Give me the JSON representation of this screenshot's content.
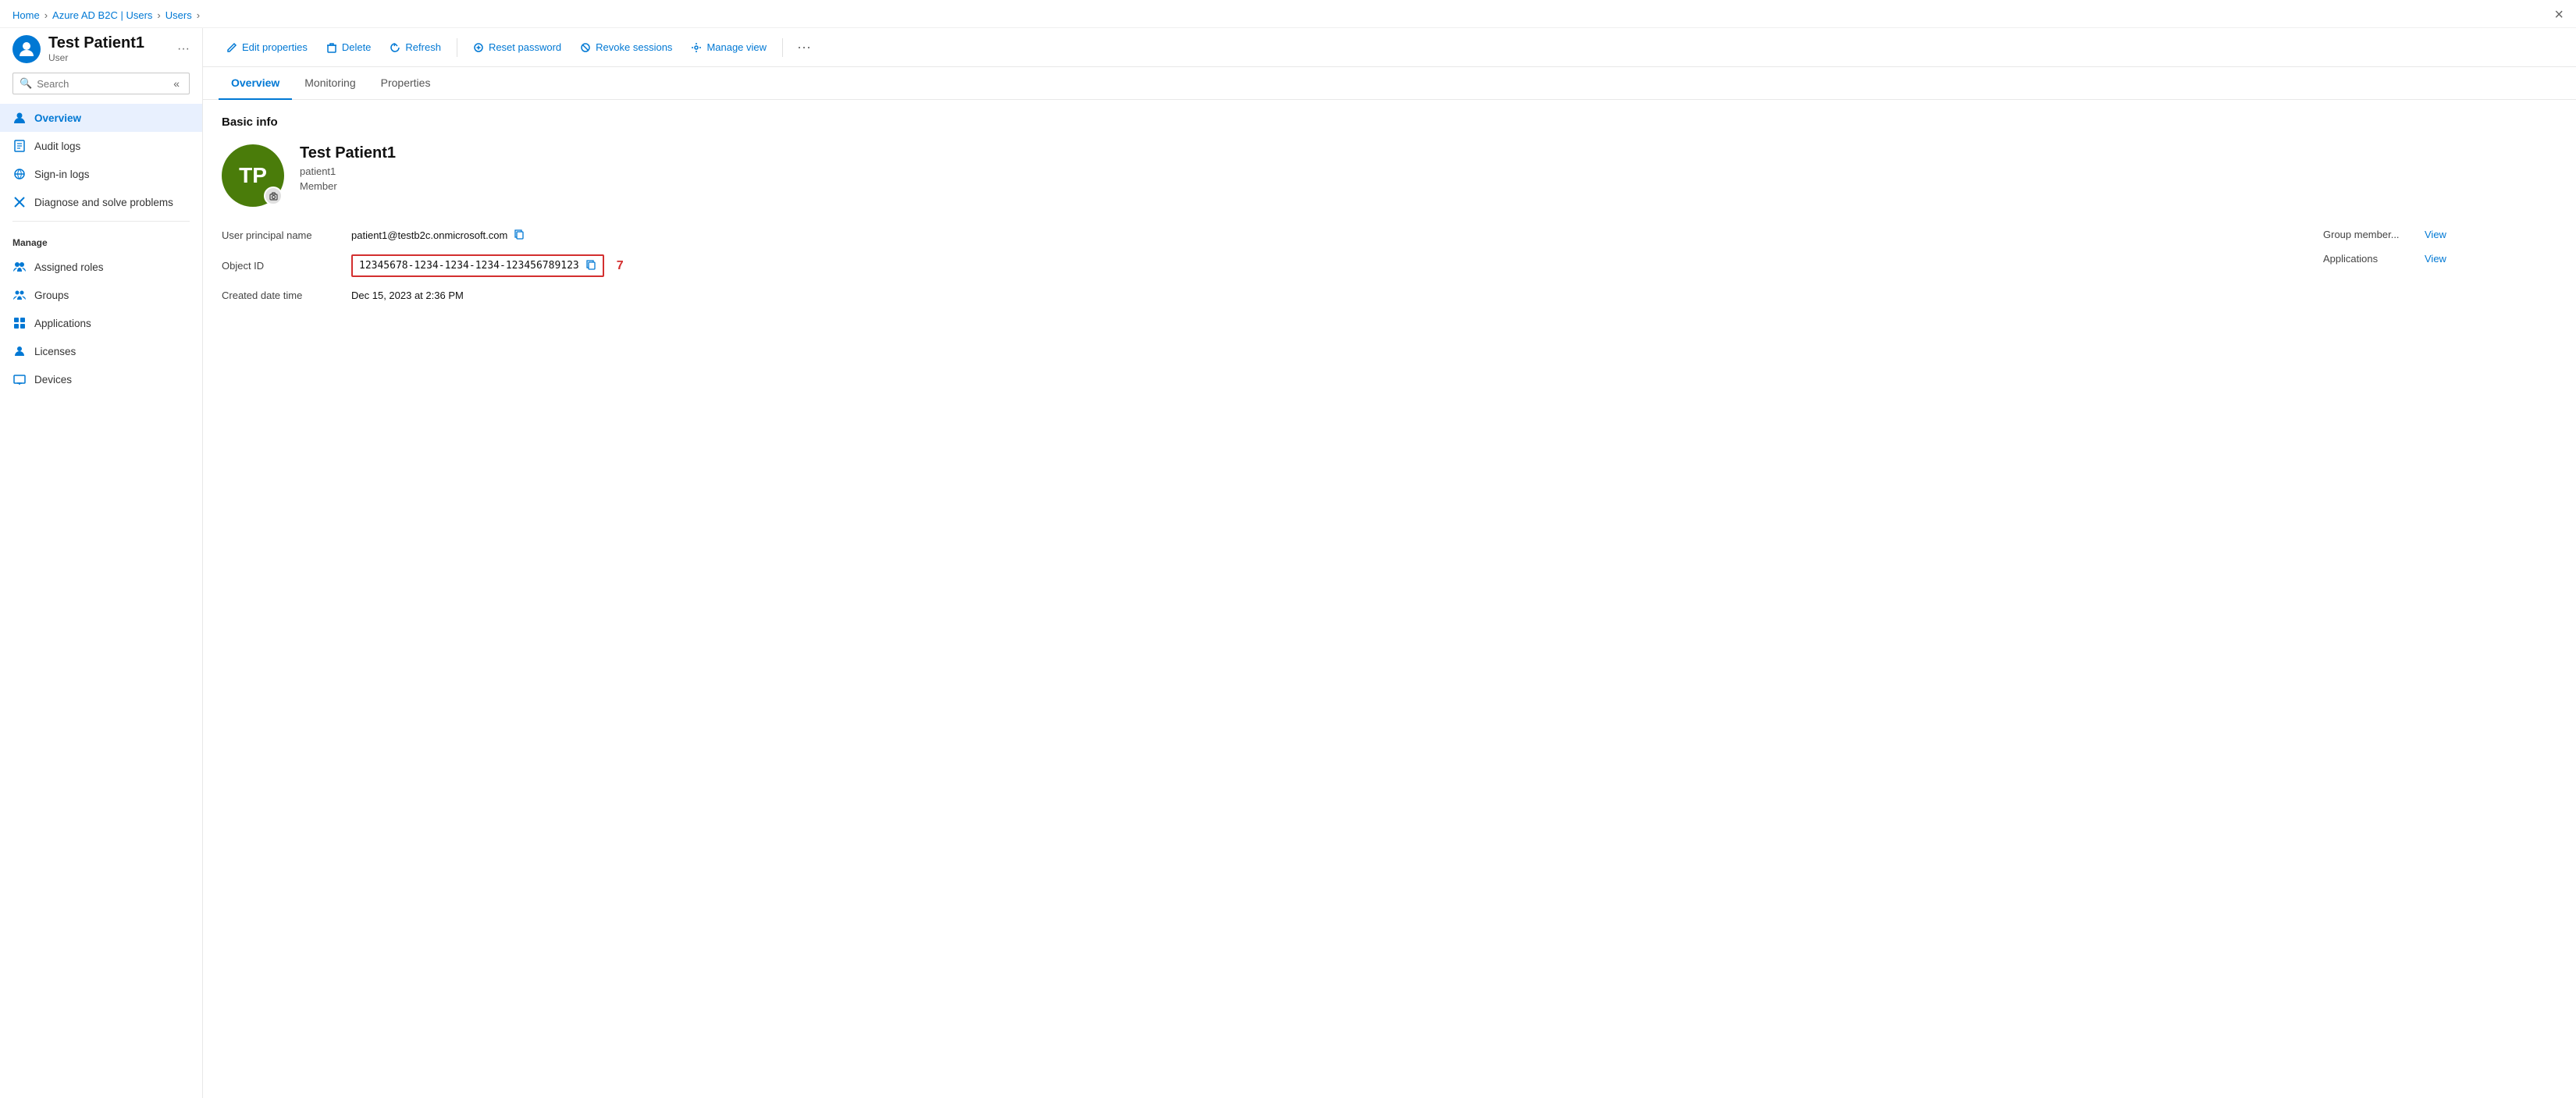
{
  "breadcrumb": {
    "items": [
      "Home",
      "Azure AD B2C | Users",
      "Users"
    ]
  },
  "page_title": "Test Patient1",
  "page_subtitle": "User",
  "more_icon": "···",
  "close_icon": "×",
  "search": {
    "placeholder": "Search"
  },
  "sidebar": {
    "items": [
      {
        "id": "overview",
        "label": "Overview",
        "icon": "👤",
        "active": true
      },
      {
        "id": "audit-logs",
        "label": "Audit logs",
        "icon": "📋",
        "active": false
      },
      {
        "id": "sign-in-logs",
        "label": "Sign-in logs",
        "icon": "🔄",
        "active": false
      },
      {
        "id": "diagnose",
        "label": "Diagnose and solve problems",
        "icon": "✖",
        "active": false
      }
    ],
    "manage_section": "Manage",
    "manage_items": [
      {
        "id": "assigned-roles",
        "label": "Assigned roles",
        "icon": "👥"
      },
      {
        "id": "groups",
        "label": "Groups",
        "icon": "👥"
      },
      {
        "id": "applications",
        "label": "Applications",
        "icon": "⊞"
      },
      {
        "id": "licenses",
        "label": "Licenses",
        "icon": "👤"
      },
      {
        "id": "devices",
        "label": "Devices",
        "icon": "💻"
      }
    ]
  },
  "toolbar": {
    "edit_properties": "Edit properties",
    "delete": "Delete",
    "refresh": "Refresh",
    "reset_password": "Reset password",
    "revoke_sessions": "Revoke sessions",
    "manage_view": "Manage view"
  },
  "tabs": [
    {
      "id": "overview",
      "label": "Overview",
      "active": true
    },
    {
      "id": "monitoring",
      "label": "Monitoring",
      "active": false
    },
    {
      "id": "properties",
      "label": "Properties",
      "active": false
    }
  ],
  "basic_info_title": "Basic info",
  "profile": {
    "initials": "TP",
    "name": "Test Patient1",
    "username": "patient1",
    "role": "Member"
  },
  "fields": {
    "upn_label": "User principal name",
    "upn_value": "patient1@testb2c.onmicrosoft.com",
    "object_id_label": "Object ID",
    "object_id_value": "12345678-1234-1234-1234-123456789123",
    "object_id_number": "7",
    "created_label": "Created date time",
    "created_value": "Dec 15, 2023 at 2:36 PM"
  },
  "right_fields": {
    "group_member_label": "Group member...",
    "group_member_link": "View",
    "applications_label": "Applications",
    "applications_link": "View"
  }
}
